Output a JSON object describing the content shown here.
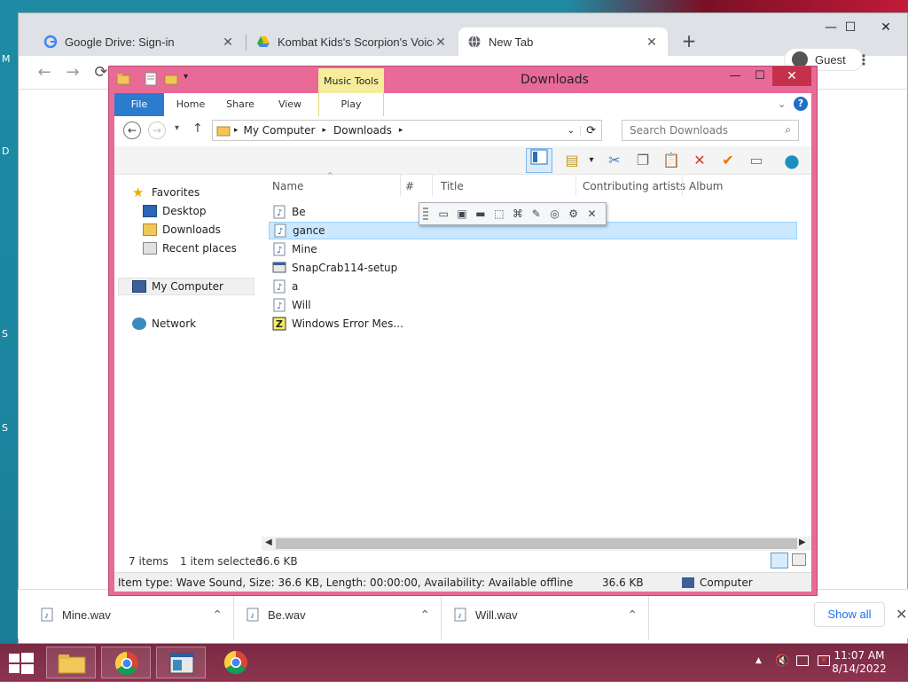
{
  "desktop": {
    "letters": [
      "M",
      "D",
      "S",
      "S"
    ]
  },
  "browser": {
    "tabs": [
      {
        "title": "Google Drive: Sign-in",
        "icon": "google-icon"
      },
      {
        "title": "Kombat Kids's Scorpion's Voice F",
        "icon": "drive-icon"
      },
      {
        "title": "New Tab",
        "icon": "globe-icon"
      }
    ],
    "new_tab": "+",
    "profile": "Guest",
    "kebab": "⋮",
    "window_controls": {
      "minimize": "—",
      "maximize": "☐",
      "close": "✕"
    }
  },
  "explorer": {
    "title": "Downloads",
    "music_tools": "Music Tools",
    "ribbon_tabs": [
      "File",
      "Home",
      "Share",
      "View",
      "Play"
    ],
    "path": [
      "My Computer",
      "Downloads"
    ],
    "search_placeholder": "Search Downloads",
    "nav": {
      "favorites": "Favorites",
      "items": [
        "Desktop",
        "Downloads",
        "Recent places"
      ],
      "my_computer": "My Computer",
      "network": "Network"
    },
    "columns": [
      "Name",
      "#",
      "Title",
      "Contributing artists",
      "Album"
    ],
    "files": [
      {
        "name": "Be",
        "icon": "audio-file-icon"
      },
      {
        "name": "gance",
        "icon": "audio-file-icon",
        "selected": true
      },
      {
        "name": "Mine",
        "icon": "audio-file-icon"
      },
      {
        "name": "SnapCrab114-setup",
        "icon": "installer-icon"
      },
      {
        "name": "a",
        "icon": "audio-file-icon"
      },
      {
        "name": "Will",
        "icon": "audio-file-icon"
      },
      {
        "name": "Windows Error Mes...",
        "icon": "zip-icon"
      }
    ],
    "status": {
      "count": "7 items",
      "selected": "1 item selected",
      "size": "36.6 KB"
    },
    "details": {
      "text": "Item type: Wave Sound, Size: 36.6 KB, Length: 00:00:00, Availability: Available offline",
      "size": "36.6 KB",
      "location": "Computer"
    }
  },
  "downloads_shelf": {
    "items": [
      "Mine.wav",
      "Be.wav",
      "Will.wav"
    ],
    "show_all": "Show all"
  },
  "taskbar": {
    "time": "11:07 AM",
    "date": "8/14/2022"
  }
}
